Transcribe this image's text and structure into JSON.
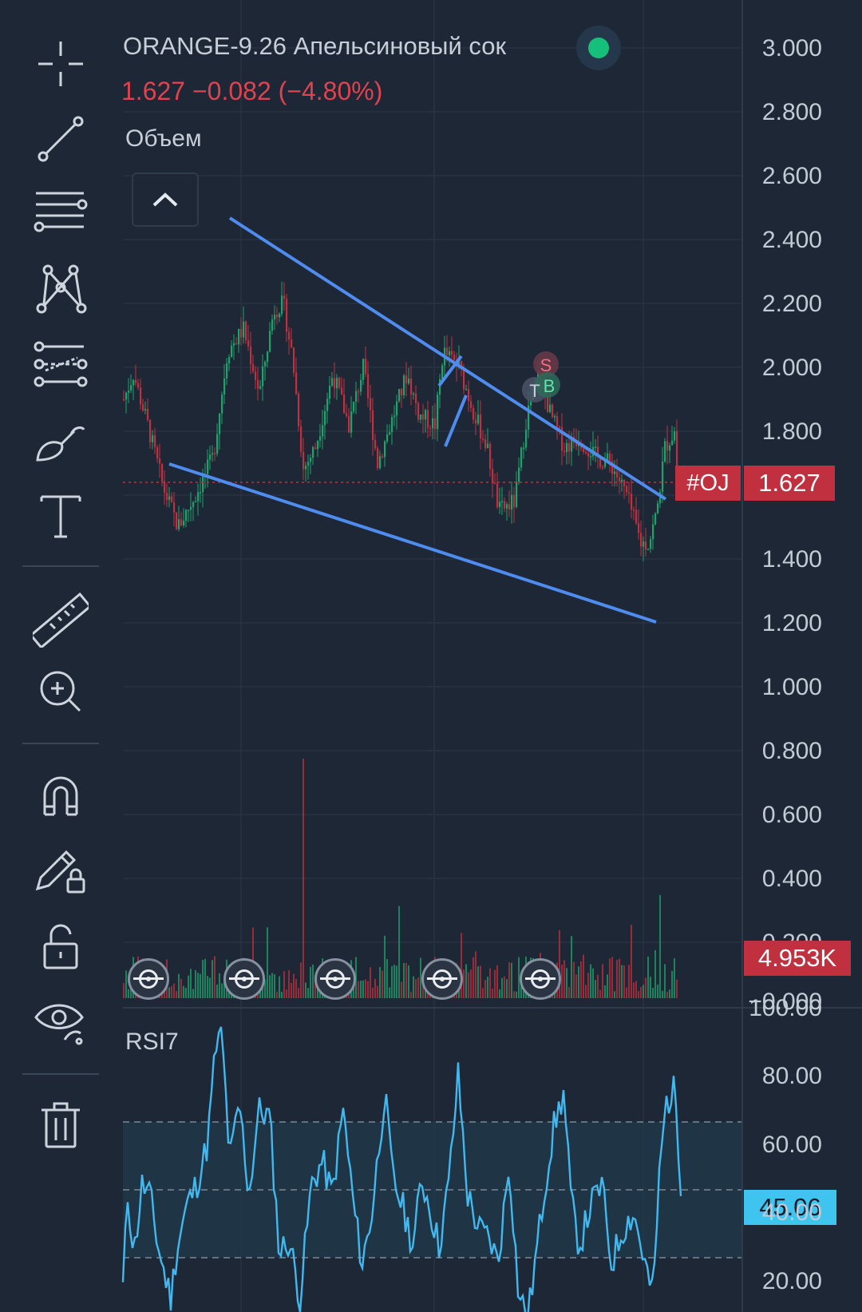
{
  "header": {
    "title": "ORANGE-9.26 Апельсиновый сок",
    "price_line": "1.627  −0.082 (−4.80%)",
    "volume_label": "Объем",
    "live_status_color": "#17c07a"
  },
  "price_axis": {
    "labels": [
      "3.000",
      "2.800",
      "2.600",
      "2.400",
      "2.200",
      "2.000",
      "1.800",
      "1.400",
      "1.200",
      "1.000",
      "0.800",
      "0.600",
      "0.400",
      "0.200",
      "−0.000"
    ]
  },
  "tags": {
    "symbol": "#OJ",
    "last_price": "1.627",
    "volume": "4.953K",
    "rsi_value": "45.06"
  },
  "rsi": {
    "label": "RSI7",
    "axis_labels": [
      "100.00",
      "80.00",
      "60.00",
      "40.00",
      "20.00"
    ],
    "overbought": 70,
    "oversold": 30
  },
  "markers": {
    "sell": "S",
    "buy": "B",
    "take": "T"
  },
  "toolbar": {
    "tools": [
      "crosshair-icon",
      "trend-line-icon",
      "fib-lines-icon",
      "pattern-icon",
      "prediction-icon",
      "brush-icon",
      "text-icon",
      "ruler-icon",
      "zoom-in-icon",
      "magnet-icon",
      "lock-drawing-icon",
      "unlock-icon",
      "eye-icon",
      "trash-icon"
    ]
  },
  "colors": {
    "background": "#1e2736",
    "up": "#1fa36b",
    "down": "#c0303e",
    "trendline": "#4f8cf0",
    "rsi_line": "#42b8ee"
  }
}
